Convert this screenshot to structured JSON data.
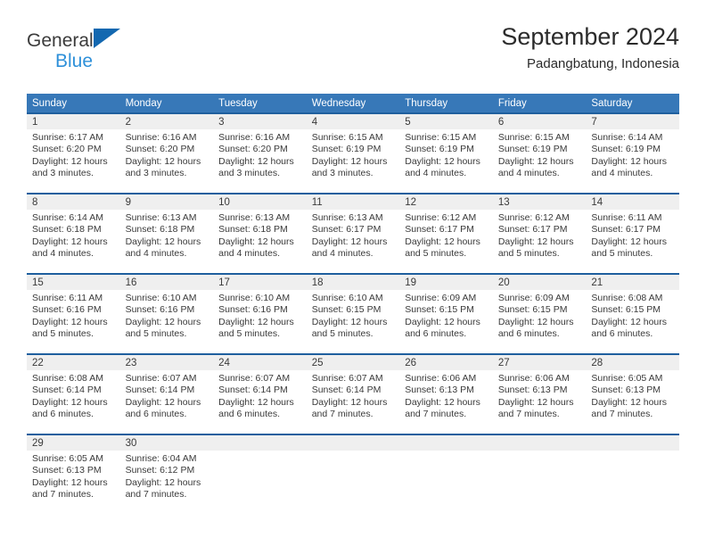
{
  "brand": {
    "name_part1": "General",
    "name_part2": "Blue",
    "logo_icon": "triangle-logo-icon"
  },
  "header": {
    "title": "September 2024",
    "subtitle": "Padangbatung, Indonesia"
  },
  "colors": {
    "header_blue": "#3778b8",
    "row_border_blue": "#1f5f9e",
    "daynum_bar": "#efefef",
    "brand_blue": "#2e90d9",
    "logo_blue": "#1368b0",
    "text": "#3a3a3a"
  },
  "weekday_headers": [
    "Sunday",
    "Monday",
    "Tuesday",
    "Wednesday",
    "Thursday",
    "Friday",
    "Saturday"
  ],
  "labels": {
    "sunrise_prefix": "Sunrise:",
    "sunset_prefix": "Sunset:",
    "daylight_prefix": "Daylight:"
  },
  "weeks": [
    [
      {
        "day": "1",
        "sunrise": "Sunrise: 6:17 AM",
        "sunset": "Sunset: 6:20 PM",
        "daylight": "Daylight: 12 hours and 3 minutes."
      },
      {
        "day": "2",
        "sunrise": "Sunrise: 6:16 AM",
        "sunset": "Sunset: 6:20 PM",
        "daylight": "Daylight: 12 hours and 3 minutes."
      },
      {
        "day": "3",
        "sunrise": "Sunrise: 6:16 AM",
        "sunset": "Sunset: 6:20 PM",
        "daylight": "Daylight: 12 hours and 3 minutes."
      },
      {
        "day": "4",
        "sunrise": "Sunrise: 6:15 AM",
        "sunset": "Sunset: 6:19 PM",
        "daylight": "Daylight: 12 hours and 3 minutes."
      },
      {
        "day": "5",
        "sunrise": "Sunrise: 6:15 AM",
        "sunset": "Sunset: 6:19 PM",
        "daylight": "Daylight: 12 hours and 4 minutes."
      },
      {
        "day": "6",
        "sunrise": "Sunrise: 6:15 AM",
        "sunset": "Sunset: 6:19 PM",
        "daylight": "Daylight: 12 hours and 4 minutes."
      },
      {
        "day": "7",
        "sunrise": "Sunrise: 6:14 AM",
        "sunset": "Sunset: 6:19 PM",
        "daylight": "Daylight: 12 hours and 4 minutes."
      }
    ],
    [
      {
        "day": "8",
        "sunrise": "Sunrise: 6:14 AM",
        "sunset": "Sunset: 6:18 PM",
        "daylight": "Daylight: 12 hours and 4 minutes."
      },
      {
        "day": "9",
        "sunrise": "Sunrise: 6:13 AM",
        "sunset": "Sunset: 6:18 PM",
        "daylight": "Daylight: 12 hours and 4 minutes."
      },
      {
        "day": "10",
        "sunrise": "Sunrise: 6:13 AM",
        "sunset": "Sunset: 6:18 PM",
        "daylight": "Daylight: 12 hours and 4 minutes."
      },
      {
        "day": "11",
        "sunrise": "Sunrise: 6:13 AM",
        "sunset": "Sunset: 6:17 PM",
        "daylight": "Daylight: 12 hours and 4 minutes."
      },
      {
        "day": "12",
        "sunrise": "Sunrise: 6:12 AM",
        "sunset": "Sunset: 6:17 PM",
        "daylight": "Daylight: 12 hours and 5 minutes."
      },
      {
        "day": "13",
        "sunrise": "Sunrise: 6:12 AM",
        "sunset": "Sunset: 6:17 PM",
        "daylight": "Daylight: 12 hours and 5 minutes."
      },
      {
        "day": "14",
        "sunrise": "Sunrise: 6:11 AM",
        "sunset": "Sunset: 6:17 PM",
        "daylight": "Daylight: 12 hours and 5 minutes."
      }
    ],
    [
      {
        "day": "15",
        "sunrise": "Sunrise: 6:11 AM",
        "sunset": "Sunset: 6:16 PM",
        "daylight": "Daylight: 12 hours and 5 minutes."
      },
      {
        "day": "16",
        "sunrise": "Sunrise: 6:10 AM",
        "sunset": "Sunset: 6:16 PM",
        "daylight": "Daylight: 12 hours and 5 minutes."
      },
      {
        "day": "17",
        "sunrise": "Sunrise: 6:10 AM",
        "sunset": "Sunset: 6:16 PM",
        "daylight": "Daylight: 12 hours and 5 minutes."
      },
      {
        "day": "18",
        "sunrise": "Sunrise: 6:10 AM",
        "sunset": "Sunset: 6:15 PM",
        "daylight": "Daylight: 12 hours and 5 minutes."
      },
      {
        "day": "19",
        "sunrise": "Sunrise: 6:09 AM",
        "sunset": "Sunset: 6:15 PM",
        "daylight": "Daylight: 12 hours and 6 minutes."
      },
      {
        "day": "20",
        "sunrise": "Sunrise: 6:09 AM",
        "sunset": "Sunset: 6:15 PM",
        "daylight": "Daylight: 12 hours and 6 minutes."
      },
      {
        "day": "21",
        "sunrise": "Sunrise: 6:08 AM",
        "sunset": "Sunset: 6:15 PM",
        "daylight": "Daylight: 12 hours and 6 minutes."
      }
    ],
    [
      {
        "day": "22",
        "sunrise": "Sunrise: 6:08 AM",
        "sunset": "Sunset: 6:14 PM",
        "daylight": "Daylight: 12 hours and 6 minutes."
      },
      {
        "day": "23",
        "sunrise": "Sunrise: 6:07 AM",
        "sunset": "Sunset: 6:14 PM",
        "daylight": "Daylight: 12 hours and 6 minutes."
      },
      {
        "day": "24",
        "sunrise": "Sunrise: 6:07 AM",
        "sunset": "Sunset: 6:14 PM",
        "daylight": "Daylight: 12 hours and 6 minutes."
      },
      {
        "day": "25",
        "sunrise": "Sunrise: 6:07 AM",
        "sunset": "Sunset: 6:14 PM",
        "daylight": "Daylight: 12 hours and 7 minutes."
      },
      {
        "day": "26",
        "sunrise": "Sunrise: 6:06 AM",
        "sunset": "Sunset: 6:13 PM",
        "daylight": "Daylight: 12 hours and 7 minutes."
      },
      {
        "day": "27",
        "sunrise": "Sunrise: 6:06 AM",
        "sunset": "Sunset: 6:13 PM",
        "daylight": "Daylight: 12 hours and 7 minutes."
      },
      {
        "day": "28",
        "sunrise": "Sunrise: 6:05 AM",
        "sunset": "Sunset: 6:13 PM",
        "daylight": "Daylight: 12 hours and 7 minutes."
      }
    ],
    [
      {
        "day": "29",
        "sunrise": "Sunrise: 6:05 AM",
        "sunset": "Sunset: 6:13 PM",
        "daylight": "Daylight: 12 hours and 7 minutes."
      },
      {
        "day": "30",
        "sunrise": "Sunrise: 6:04 AM",
        "sunset": "Sunset: 6:12 PM",
        "daylight": "Daylight: 12 hours and 7 minutes."
      },
      {
        "day": "",
        "sunrise": "",
        "sunset": "",
        "daylight": ""
      },
      {
        "day": "",
        "sunrise": "",
        "sunset": "",
        "daylight": ""
      },
      {
        "day": "",
        "sunrise": "",
        "sunset": "",
        "daylight": ""
      },
      {
        "day": "",
        "sunrise": "",
        "sunset": "",
        "daylight": ""
      },
      {
        "day": "",
        "sunrise": "",
        "sunset": "",
        "daylight": ""
      }
    ]
  ]
}
